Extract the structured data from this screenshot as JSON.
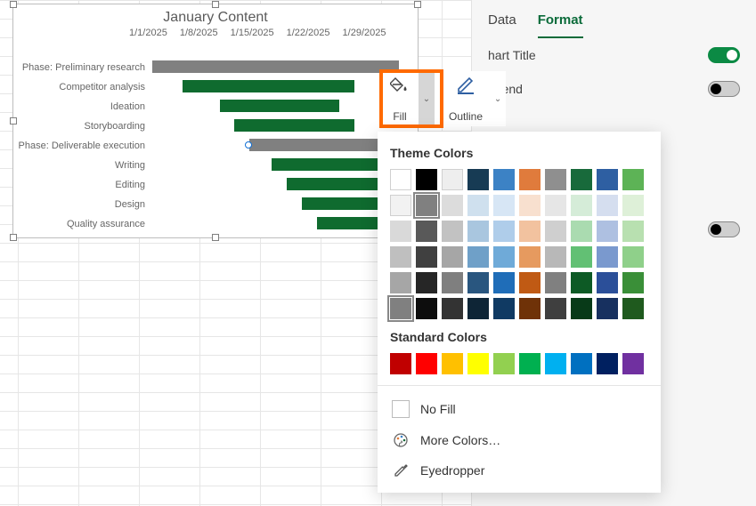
{
  "sidebar": {
    "tabs": {
      "data": "Data",
      "format": "Format"
    },
    "options": {
      "chart_title": "hart Title",
      "legend": "egend"
    }
  },
  "ribbon": {
    "fill_label": "Fill",
    "outline_label": "Outline"
  },
  "picker": {
    "theme_title": "Theme Colors",
    "standard_title": "Standard Colors",
    "no_fill": "No Fill",
    "more_colors": "More Colors…",
    "eyedropper": "Eyedropper",
    "theme_colors": [
      [
        "#ffffff",
        "#000000",
        "#eeeeee",
        "#173b54",
        "#3c82c5",
        "#e07b3c",
        "#8f8f8f",
        "#186a3b",
        "#2e5fa2",
        "#5db356"
      ],
      [
        "#f2f2f2",
        "#808080",
        "#dcdcdc",
        "#cfe0ee",
        "#d7e6f5",
        "#f8e0cf",
        "#e6e6e6",
        "#d5ecd8",
        "#d5deef",
        "#def0d8"
      ],
      [
        "#d9d9d9",
        "#595959",
        "#c2c2c2",
        "#a9c6df",
        "#afcdea",
        "#f2c29f",
        "#cfcfcf",
        "#aadbb0",
        "#aec0e1",
        "#b8e0b0"
      ],
      [
        "#bfbfbf",
        "#404040",
        "#a6a6a6",
        "#6fa0c8",
        "#6faad8",
        "#e69a5f",
        "#b8b8b8",
        "#62c074",
        "#7a99ce",
        "#8fd08a"
      ],
      [
        "#a6a6a6",
        "#262626",
        "#7f7f7f",
        "#29567f",
        "#1f6db8",
        "#c05a14",
        "#808080",
        "#0d5a25",
        "#2b4f99",
        "#3a8f38"
      ],
      [
        "#808080",
        "#0d0d0d",
        "#333333",
        "#0e2536",
        "#103a63",
        "#6f3208",
        "#3f3f3f",
        "#083a18",
        "#17305f",
        "#1f5a1e"
      ]
    ],
    "standard_colors": [
      "#c00000",
      "#ff0000",
      "#ffc000",
      "#ffff00",
      "#92d050",
      "#00b050",
      "#00b0f0",
      "#0070c0",
      "#002060",
      "#7030a0"
    ],
    "selected_theme": [
      1,
      1
    ],
    "selected_row6": [
      5,
      0
    ]
  },
  "chart_data": {
    "type": "bar",
    "title": "January Content",
    "x_ticks": [
      "1/1/2025",
      "1/8/2025",
      "1/15/2025",
      "1/22/2025",
      "1/29/2025"
    ],
    "x_range_days": [
      0,
      35
    ],
    "tasks": [
      {
        "label": "Phase: Preliminary research",
        "start": 0,
        "duration": 33,
        "color": "grey"
      },
      {
        "label": "Competitor analysis",
        "start": 4,
        "duration": 23,
        "color": "green"
      },
      {
        "label": "Ideation",
        "start": 9,
        "duration": 16,
        "color": "green"
      },
      {
        "label": "Storyboarding",
        "start": 11,
        "duration": 16,
        "color": "green"
      },
      {
        "label": "Phase: Deliverable execution",
        "start": 13,
        "duration": 20,
        "color": "grey",
        "selected": true
      },
      {
        "label": "Writing",
        "start": 16,
        "duration": 17,
        "color": "green"
      },
      {
        "label": "Editing",
        "start": 18,
        "duration": 15,
        "color": "green"
      },
      {
        "label": "Design",
        "start": 20,
        "duration": 13,
        "color": "green"
      },
      {
        "label": "Quality assurance",
        "start": 22,
        "duration": 11,
        "color": "green"
      }
    ]
  }
}
